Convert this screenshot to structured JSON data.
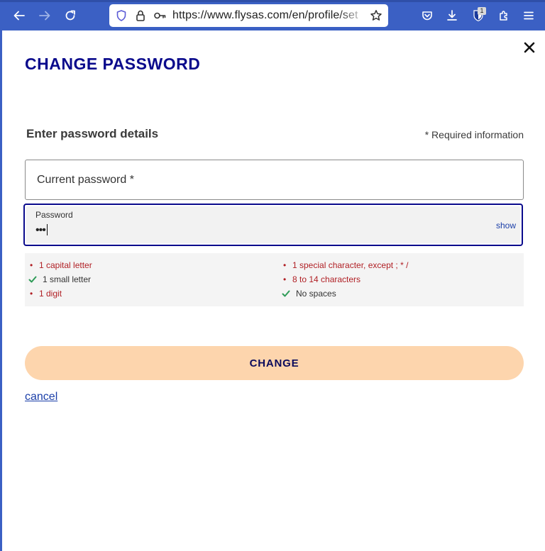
{
  "browser": {
    "url": "https://www.flysas.com/en/profile/set",
    "extension_badge": "1",
    "icons": [
      "back-arrow-icon",
      "forward-arrow-icon",
      "reload-icon",
      "shield-icon",
      "lock-icon",
      "key-icon",
      "star-icon",
      "pocket-icon",
      "download-icon",
      "bitwarden-icon",
      "extensions-icon",
      "menu-icon"
    ]
  },
  "dialog": {
    "title": "CHANGE PASSWORD",
    "subtitle": "Enter password details",
    "required_note": "* Required information",
    "current_password": {
      "label": "Current password *",
      "value": ""
    },
    "new_password": {
      "label": "Password",
      "value": "•••",
      "show_label": "show"
    },
    "rules": [
      {
        "text": "1 capital letter",
        "met": false
      },
      {
        "text": "1 special character, except ; * /",
        "met": false
      },
      {
        "text": "1 small letter",
        "met": true
      },
      {
        "text": "8 to 14 characters",
        "met": false
      },
      {
        "text": "1 digit",
        "met": false
      },
      {
        "text": "No spaces",
        "met": true
      }
    ],
    "change_button": "CHANGE",
    "cancel_link": "cancel"
  },
  "colors": {
    "browser_toolbar": "#3b60c4",
    "title": "#0a0a8c",
    "rule_unmet": "#b01f24",
    "rule_met_check": "#2e9b57",
    "button_bg": "#fdd5ad",
    "link": "#1a3ea8",
    "focus_border": "#0a0a8c"
  }
}
